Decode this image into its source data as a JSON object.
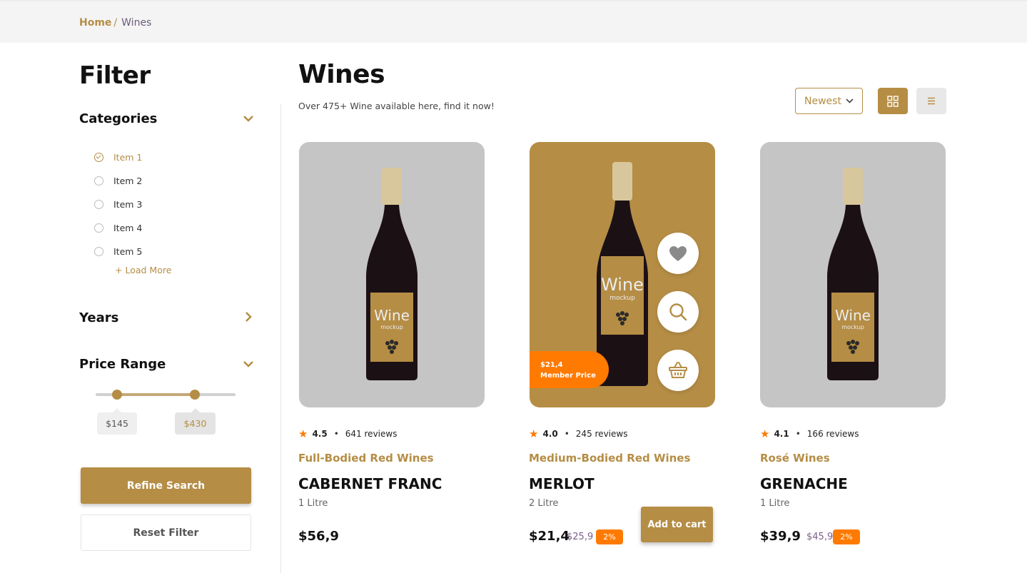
{
  "breadcrumb": {
    "home": "Home",
    "separator": "/",
    "current": "Wines"
  },
  "sidebar": {
    "title": "Filter",
    "categories": {
      "title": "Categories",
      "items": [
        {
          "label": "Item 1",
          "selected": true
        },
        {
          "label": "Item 2",
          "selected": false
        },
        {
          "label": "Item 3",
          "selected": false
        },
        {
          "label": "Item 4",
          "selected": false
        },
        {
          "label": "Item 5",
          "selected": false
        }
      ],
      "load_more": "+ Load More"
    },
    "years": {
      "title": "Years"
    },
    "price_range": {
      "title": "Price Range",
      "min_label": "$145",
      "max_label": "$430"
    },
    "refine_button": "Refine Search",
    "reset_button": "Reset Filter"
  },
  "main": {
    "title": "Wines",
    "subtitle": "Over 475+ Wine available here, find it now!",
    "sort": {
      "selected": "Newest"
    }
  },
  "products": [
    {
      "rating": "4.5",
      "reviews": "641 reviews",
      "category": "Full-Bodied Red Wines",
      "name": "CABERNET FRANC",
      "volume": "1 Litre",
      "price": "$56,9"
    },
    {
      "rating": "4.0",
      "reviews": "245 reviews",
      "category": "Medium-Bodied Red Wines",
      "name": "MERLOT",
      "volume": "2 Litre",
      "price": "$21,4",
      "old_price": "$25,9",
      "discount": "2%",
      "member_price": "$21,4",
      "member_label": "Member Price",
      "add_to_cart": "Add to cart"
    },
    {
      "rating": "4.1",
      "reviews": "166 reviews",
      "category": "Rosé Wines",
      "name": "GRENACHE",
      "volume": "1 Litre",
      "price": "$39,9",
      "old_price": "$45,9",
      "discount": "2%"
    }
  ],
  "bottle_label": {
    "brand": "Wine",
    "sub": "mockup"
  },
  "colors": {
    "accent": "#b58d45",
    "discount": "#ff7a00",
    "card_bg": "#c5c5c5"
  }
}
